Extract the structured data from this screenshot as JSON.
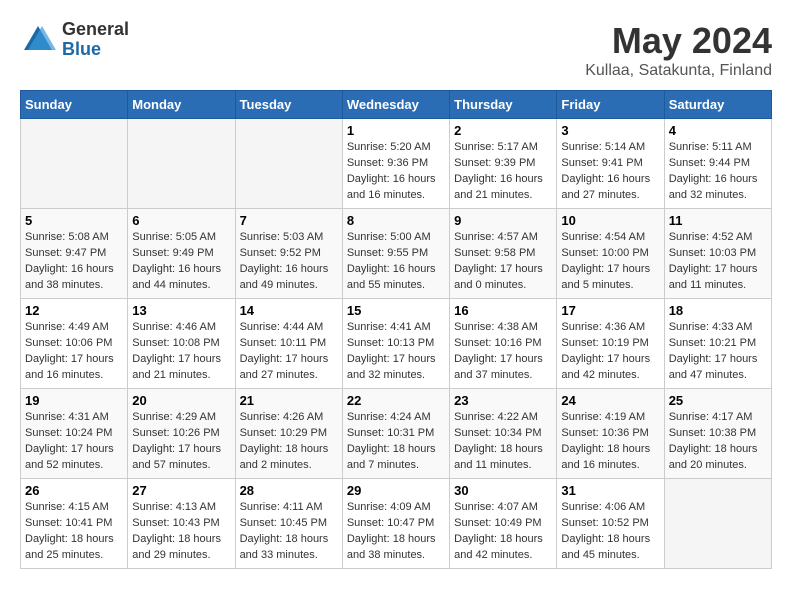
{
  "header": {
    "logo_general": "General",
    "logo_blue": "Blue",
    "month": "May 2024",
    "location": "Kullaa, Satakunta, Finland"
  },
  "days_of_week": [
    "Sunday",
    "Monday",
    "Tuesday",
    "Wednesday",
    "Thursday",
    "Friday",
    "Saturday"
  ],
  "weeks": [
    [
      {
        "day": "",
        "info": ""
      },
      {
        "day": "",
        "info": ""
      },
      {
        "day": "",
        "info": ""
      },
      {
        "day": "1",
        "info": "Sunrise: 5:20 AM\nSunset: 9:36 PM\nDaylight: 16 hours\nand 16 minutes."
      },
      {
        "day": "2",
        "info": "Sunrise: 5:17 AM\nSunset: 9:39 PM\nDaylight: 16 hours\nand 21 minutes."
      },
      {
        "day": "3",
        "info": "Sunrise: 5:14 AM\nSunset: 9:41 PM\nDaylight: 16 hours\nand 27 minutes."
      },
      {
        "day": "4",
        "info": "Sunrise: 5:11 AM\nSunset: 9:44 PM\nDaylight: 16 hours\nand 32 minutes."
      }
    ],
    [
      {
        "day": "5",
        "info": "Sunrise: 5:08 AM\nSunset: 9:47 PM\nDaylight: 16 hours\nand 38 minutes."
      },
      {
        "day": "6",
        "info": "Sunrise: 5:05 AM\nSunset: 9:49 PM\nDaylight: 16 hours\nand 44 minutes."
      },
      {
        "day": "7",
        "info": "Sunrise: 5:03 AM\nSunset: 9:52 PM\nDaylight: 16 hours\nand 49 minutes."
      },
      {
        "day": "8",
        "info": "Sunrise: 5:00 AM\nSunset: 9:55 PM\nDaylight: 16 hours\nand 55 minutes."
      },
      {
        "day": "9",
        "info": "Sunrise: 4:57 AM\nSunset: 9:58 PM\nDaylight: 17 hours\nand 0 minutes."
      },
      {
        "day": "10",
        "info": "Sunrise: 4:54 AM\nSunset: 10:00 PM\nDaylight: 17 hours\nand 5 minutes."
      },
      {
        "day": "11",
        "info": "Sunrise: 4:52 AM\nSunset: 10:03 PM\nDaylight: 17 hours\nand 11 minutes."
      }
    ],
    [
      {
        "day": "12",
        "info": "Sunrise: 4:49 AM\nSunset: 10:06 PM\nDaylight: 17 hours\nand 16 minutes."
      },
      {
        "day": "13",
        "info": "Sunrise: 4:46 AM\nSunset: 10:08 PM\nDaylight: 17 hours\nand 21 minutes."
      },
      {
        "day": "14",
        "info": "Sunrise: 4:44 AM\nSunset: 10:11 PM\nDaylight: 17 hours\nand 27 minutes."
      },
      {
        "day": "15",
        "info": "Sunrise: 4:41 AM\nSunset: 10:13 PM\nDaylight: 17 hours\nand 32 minutes."
      },
      {
        "day": "16",
        "info": "Sunrise: 4:38 AM\nSunset: 10:16 PM\nDaylight: 17 hours\nand 37 minutes."
      },
      {
        "day": "17",
        "info": "Sunrise: 4:36 AM\nSunset: 10:19 PM\nDaylight: 17 hours\nand 42 minutes."
      },
      {
        "day": "18",
        "info": "Sunrise: 4:33 AM\nSunset: 10:21 PM\nDaylight: 17 hours\nand 47 minutes."
      }
    ],
    [
      {
        "day": "19",
        "info": "Sunrise: 4:31 AM\nSunset: 10:24 PM\nDaylight: 17 hours\nand 52 minutes."
      },
      {
        "day": "20",
        "info": "Sunrise: 4:29 AM\nSunset: 10:26 PM\nDaylight: 17 hours\nand 57 minutes."
      },
      {
        "day": "21",
        "info": "Sunrise: 4:26 AM\nSunset: 10:29 PM\nDaylight: 18 hours\nand 2 minutes."
      },
      {
        "day": "22",
        "info": "Sunrise: 4:24 AM\nSunset: 10:31 PM\nDaylight: 18 hours\nand 7 minutes."
      },
      {
        "day": "23",
        "info": "Sunrise: 4:22 AM\nSunset: 10:34 PM\nDaylight: 18 hours\nand 11 minutes."
      },
      {
        "day": "24",
        "info": "Sunrise: 4:19 AM\nSunset: 10:36 PM\nDaylight: 18 hours\nand 16 minutes."
      },
      {
        "day": "25",
        "info": "Sunrise: 4:17 AM\nSunset: 10:38 PM\nDaylight: 18 hours\nand 20 minutes."
      }
    ],
    [
      {
        "day": "26",
        "info": "Sunrise: 4:15 AM\nSunset: 10:41 PM\nDaylight: 18 hours\nand 25 minutes."
      },
      {
        "day": "27",
        "info": "Sunrise: 4:13 AM\nSunset: 10:43 PM\nDaylight: 18 hours\nand 29 minutes."
      },
      {
        "day": "28",
        "info": "Sunrise: 4:11 AM\nSunset: 10:45 PM\nDaylight: 18 hours\nand 33 minutes."
      },
      {
        "day": "29",
        "info": "Sunrise: 4:09 AM\nSunset: 10:47 PM\nDaylight: 18 hours\nand 38 minutes."
      },
      {
        "day": "30",
        "info": "Sunrise: 4:07 AM\nSunset: 10:49 PM\nDaylight: 18 hours\nand 42 minutes."
      },
      {
        "day": "31",
        "info": "Sunrise: 4:06 AM\nSunset: 10:52 PM\nDaylight: 18 hours\nand 45 minutes."
      },
      {
        "day": "",
        "info": ""
      }
    ]
  ]
}
